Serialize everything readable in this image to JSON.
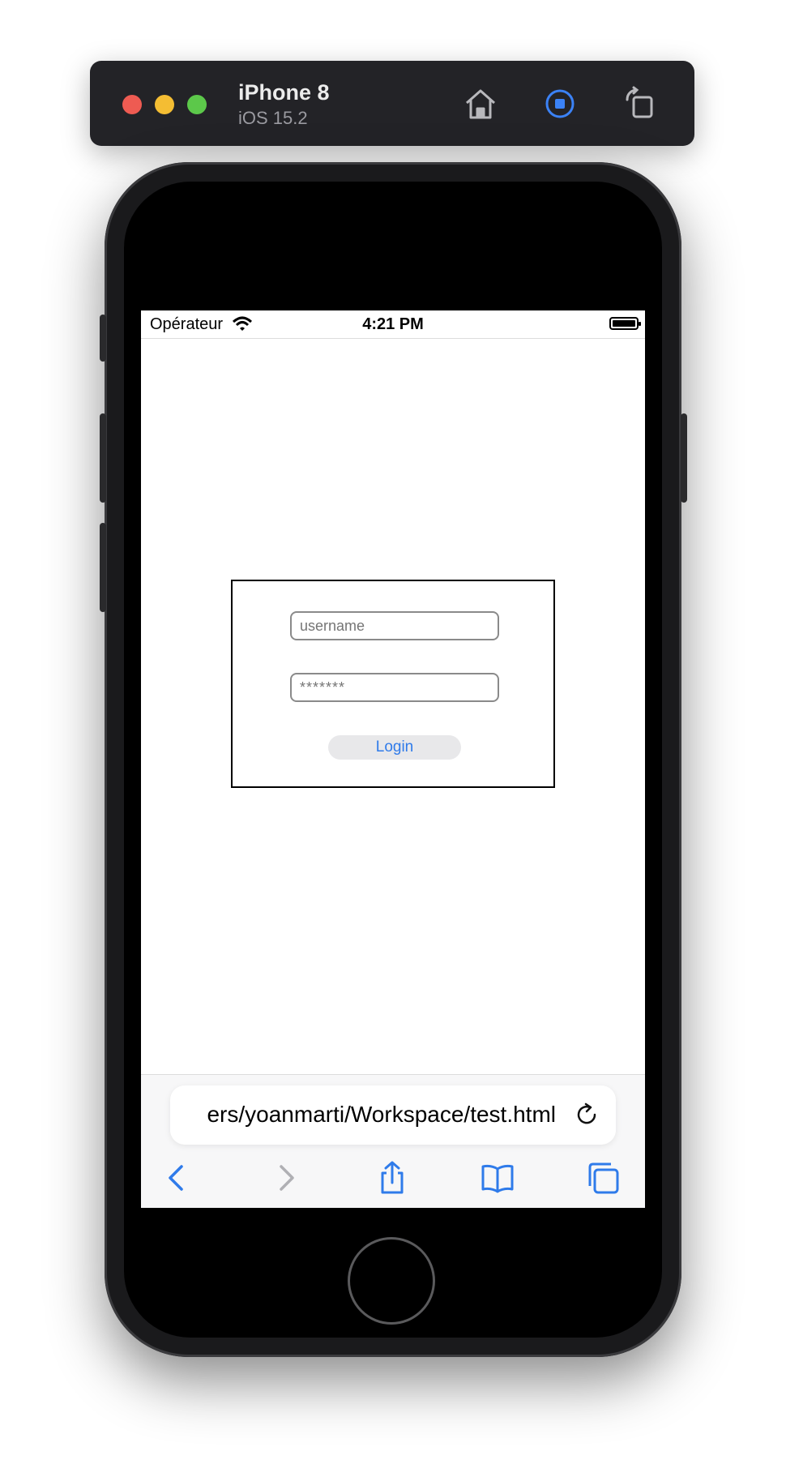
{
  "simulator": {
    "device_name": "iPhone 8",
    "os_version": "iOS 15.2",
    "icons": [
      "home-icon",
      "screenshot-icon",
      "rotate-icon"
    ]
  },
  "status_bar": {
    "carrier": "Opérateur",
    "time": "4:21 PM",
    "icons": [
      "wifi-icon",
      "battery-icon"
    ]
  },
  "login": {
    "username_placeholder": "username",
    "password_placeholder": "*******",
    "button_label": "Login"
  },
  "browser": {
    "url": "ers/yoanmarti/Workspace/test.html",
    "accent_color": "#2f7bea",
    "icons": [
      "back-icon",
      "forward-icon",
      "share-icon",
      "bookmarks-icon",
      "tabs-icon",
      "reload-icon"
    ]
  }
}
